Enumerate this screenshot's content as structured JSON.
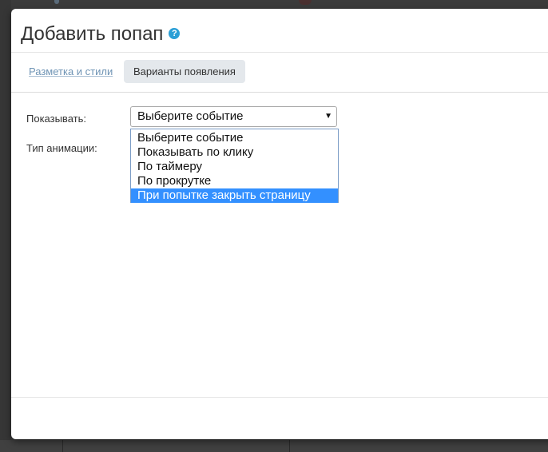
{
  "modal": {
    "title": "Добавить попап",
    "help_icon_glyph": "?",
    "help_icon_name": "question-circle-icon",
    "accent_color": "#2a9fd6"
  },
  "tabs": [
    {
      "label": "Разметка и стили",
      "active": false
    },
    {
      "label": "Варианты появления",
      "active": true
    }
  ],
  "form": {
    "show_label": "Показывать:",
    "animation_label": "Тип анимации:",
    "show_select": {
      "value": "Выберите событие",
      "arrow_glyph": "▼",
      "options": [
        "Выберите событие",
        "Показывать по клику",
        "По таймеру",
        "По прокрутке",
        "При попытке закрыть страницу"
      ],
      "highlighted_option": "При попытке закрыть страницу",
      "highlight_color": "#3390ff"
    }
  }
}
